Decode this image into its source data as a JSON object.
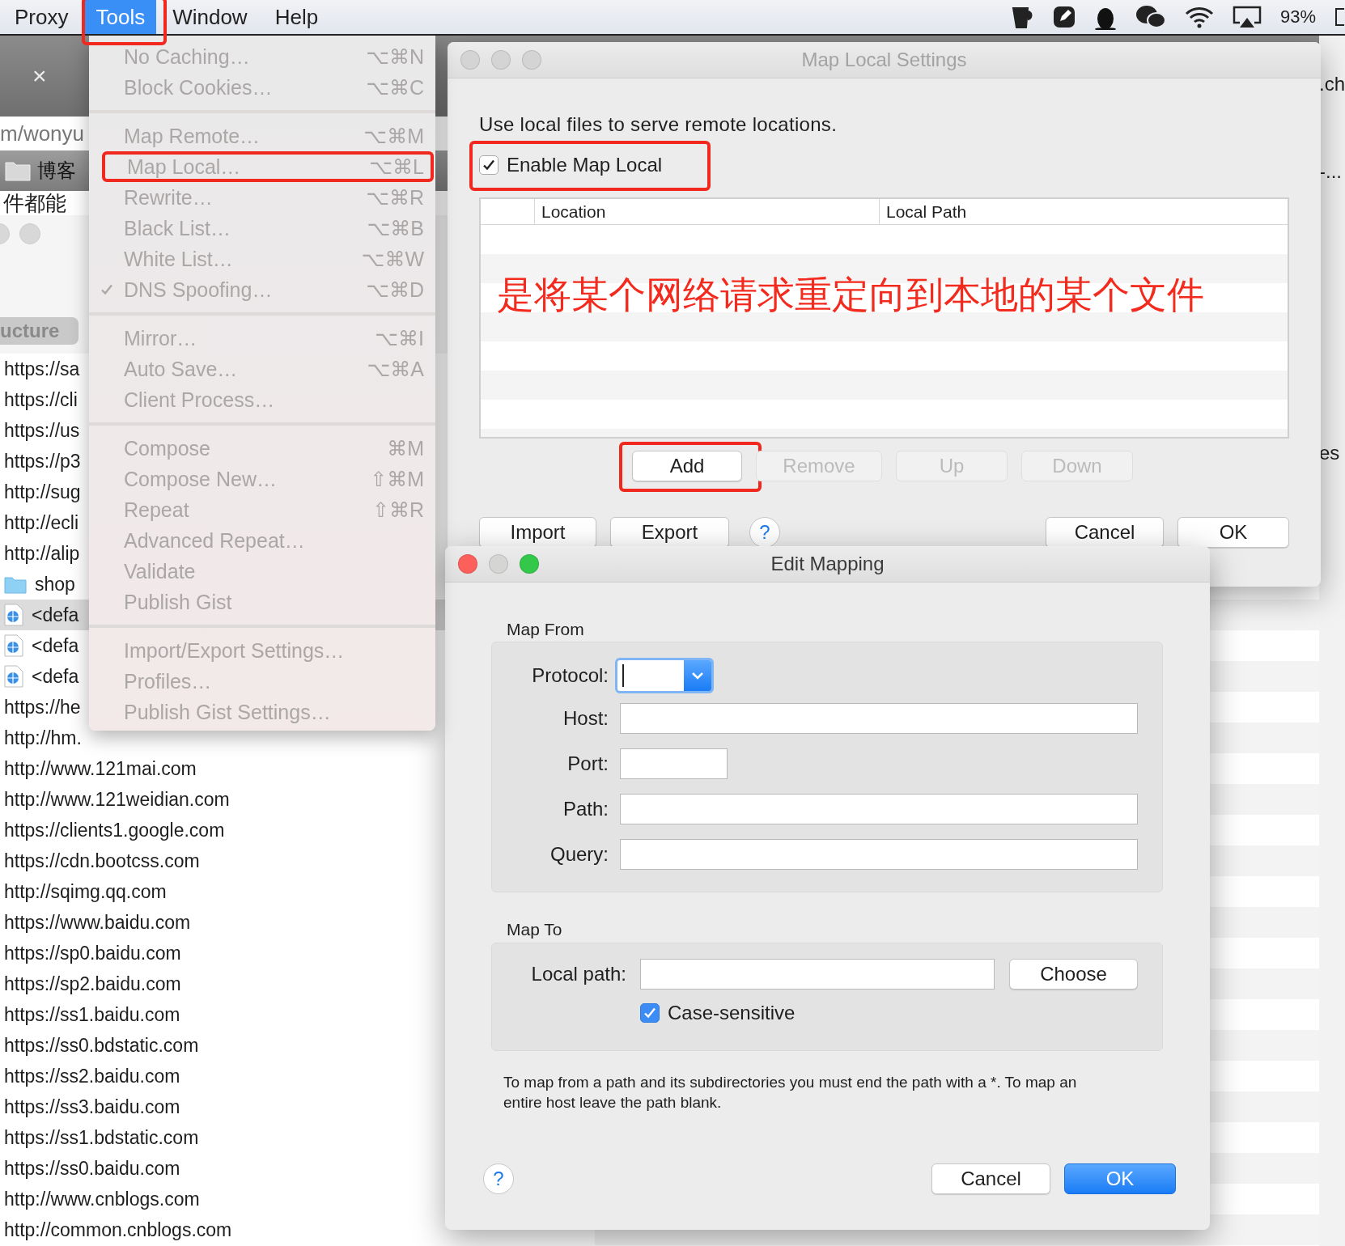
{
  "menu_bar": {
    "items": [
      {
        "label": "Proxy",
        "selected": false,
        "annotated": false
      },
      {
        "label": "Tools",
        "selected": true,
        "annotated": true
      },
      {
        "label": "Window",
        "selected": false,
        "annotated": false
      },
      {
        "label": "Help",
        "selected": false,
        "annotated": false
      }
    ],
    "battery": "93%"
  },
  "background_window": {
    "tab_close": "×",
    "address": "m/wonyu",
    "bookmark": "博客",
    "page_text": "件都能",
    "sidebar_tab": "ucture",
    "rows": [
      {
        "text": "https://sa",
        "kind": "url",
        "selected": false
      },
      {
        "text": "https://cli",
        "kind": "url",
        "selected": false
      },
      {
        "text": "https://us",
        "kind": "url",
        "selected": false
      },
      {
        "text": "https://p3",
        "kind": "url",
        "selected": false
      },
      {
        "text": "http://sug",
        "kind": "url",
        "selected": false
      },
      {
        "text": "http://ecli",
        "kind": "url",
        "selected": false
      },
      {
        "text": "http://alip",
        "kind": "url",
        "selected": false
      },
      {
        "text": "shop",
        "kind": "folder",
        "selected": false
      },
      {
        "text": "<defa",
        "kind": "file",
        "selected": true
      },
      {
        "text": "<defa",
        "kind": "file",
        "selected": false
      },
      {
        "text": "<defa",
        "kind": "file",
        "selected": false
      },
      {
        "text": "https://he",
        "kind": "url",
        "selected": false
      },
      {
        "text": "http://hm.",
        "kind": "url",
        "selected": false
      },
      {
        "text": "http://www.121mai.com",
        "kind": "url",
        "selected": false
      },
      {
        "text": "http://www.121weidian.com",
        "kind": "url",
        "selected": false
      },
      {
        "text": "https://clients1.google.com",
        "kind": "url",
        "selected": false
      },
      {
        "text": "https://cdn.bootcss.com",
        "kind": "url",
        "selected": false
      },
      {
        "text": "http://sqimg.qq.com",
        "kind": "url",
        "selected": false
      },
      {
        "text": "https://www.baidu.com",
        "kind": "url",
        "selected": false
      },
      {
        "text": "https://sp0.baidu.com",
        "kind": "url",
        "selected": false
      },
      {
        "text": "https://sp2.baidu.com",
        "kind": "url",
        "selected": false
      },
      {
        "text": "https://ss1.baidu.com",
        "kind": "url",
        "selected": false
      },
      {
        "text": "https://ss0.bdstatic.com",
        "kind": "url",
        "selected": false
      },
      {
        "text": "https://ss2.baidu.com",
        "kind": "url",
        "selected": false
      },
      {
        "text": "https://ss3.baidu.com",
        "kind": "url",
        "selected": false
      },
      {
        "text": "https://ss1.bdstatic.com",
        "kind": "url",
        "selected": false
      },
      {
        "text": "https://ss0.baidu.com",
        "kind": "url",
        "selected": false
      },
      {
        "text": "http://www.cnblogs.com",
        "kind": "url",
        "selected": false
      },
      {
        "text": "http://common.cnblogs.com",
        "kind": "url",
        "selected": false
      }
    ],
    "right_texts": [
      ".ch",
      "-...",
      "es"
    ]
  },
  "tools_menu": {
    "groups": [
      [
        {
          "label": "No Caching…",
          "shortcut": "⌥⌘N",
          "disabled": true,
          "checked": false,
          "annotated": false
        },
        {
          "label": "Block Cookies…",
          "shortcut": "⌥⌘C",
          "disabled": true,
          "checked": false,
          "annotated": false
        }
      ],
      [
        {
          "label": "Map Remote…",
          "shortcut": "⌥⌘M",
          "disabled": true,
          "checked": false,
          "annotated": false
        },
        {
          "label": "Map Local…",
          "shortcut": "⌥⌘L",
          "disabled": true,
          "checked": false,
          "annotated": true
        },
        {
          "label": "Rewrite…",
          "shortcut": "⌥⌘R",
          "disabled": true,
          "checked": false,
          "annotated": false
        },
        {
          "label": "Black List…",
          "shortcut": "⌥⌘B",
          "disabled": true,
          "checked": false,
          "annotated": false
        },
        {
          "label": "White List…",
          "shortcut": "⌥⌘W",
          "disabled": true,
          "checked": false,
          "annotated": false
        },
        {
          "label": "DNS Spoofing…",
          "shortcut": "⌥⌘D",
          "disabled": true,
          "checked": true,
          "annotated": false
        }
      ],
      [
        {
          "label": "Mirror…",
          "shortcut": "⌥⌘I",
          "disabled": true,
          "checked": false,
          "annotated": false
        },
        {
          "label": "Auto Save…",
          "shortcut": "⌥⌘A",
          "disabled": true,
          "checked": false,
          "annotated": false
        },
        {
          "label": "Client Process…",
          "disabled": true,
          "checked": false,
          "annotated": false
        }
      ],
      [
        {
          "label": "Compose",
          "shortcut": "⌘M",
          "disabled": true,
          "checked": false,
          "annotated": false
        },
        {
          "label": "Compose New…",
          "shortcut": "⇧⌘M",
          "disabled": true,
          "checked": false,
          "annotated": false
        },
        {
          "label": "Repeat",
          "shortcut": "⇧⌘R",
          "disabled": true,
          "checked": false,
          "annotated": false
        },
        {
          "label": "Advanced Repeat…",
          "disabled": true,
          "checked": false,
          "annotated": false
        },
        {
          "label": "Validate",
          "disabled": true,
          "checked": false,
          "annotated": false
        },
        {
          "label": "Publish Gist",
          "disabled": true,
          "checked": false,
          "annotated": false
        }
      ],
      [
        {
          "label": "Import/Export Settings…",
          "disabled": true,
          "checked": false,
          "annotated": false
        },
        {
          "label": "Profiles…",
          "disabled": true,
          "checked": false,
          "annotated": false
        },
        {
          "label": "Publish Gist Settings…",
          "disabled": true,
          "checked": false,
          "annotated": false
        }
      ]
    ]
  },
  "map_local_settings": {
    "title": "Map Local Settings",
    "active": false,
    "description": "Use local files to serve remote locations.",
    "enable": {
      "label": "Enable Map Local",
      "checked": true,
      "annotated": true
    },
    "table": {
      "columns": [
        {
          "label": "Location"
        },
        {
          "label": "Local Path"
        }
      ]
    },
    "annotation": "是将某个网络请求重定向到本地的某个文件",
    "row_buttons": [
      {
        "label": "Add",
        "disabled": false,
        "annotated": true
      },
      {
        "label": "Remove",
        "disabled": true,
        "annotated": false
      },
      {
        "label": "Up",
        "disabled": true,
        "annotated": false
      },
      {
        "label": "Down",
        "disabled": true,
        "annotated": false
      }
    ],
    "left_buttons": [
      "Import",
      "Export"
    ],
    "help": "?",
    "right_buttons": [
      "Cancel",
      "OK"
    ]
  },
  "edit_mapping": {
    "title": "Edit Mapping",
    "active": true,
    "lights": [
      {
        "kind": "close",
        "enabled": true
      },
      {
        "kind": "minimize",
        "enabled": false
      },
      {
        "kind": "zoom",
        "enabled": true
      }
    ],
    "map_from": {
      "title": "Map From",
      "fields": [
        {
          "label": "Protocol:",
          "kind": "select"
        },
        {
          "label": "Host:",
          "kind": "wide"
        },
        {
          "label": "Port:",
          "kind": "short"
        },
        {
          "label": "Path:",
          "kind": "wide"
        },
        {
          "label": "Query:",
          "kind": "wide"
        }
      ]
    },
    "map_to": {
      "title": "Map To",
      "local_path_label": "Local path:",
      "choose": "Choose",
      "case_sensitive": {
        "label": "Case-sensitive",
        "checked": true
      }
    },
    "note": "To map from a path and its subdirectories you must end the path with a *. To map an entire host leave the path blank.",
    "help": "?",
    "buttons": [
      {
        "label": "Cancel",
        "primary": false
      },
      {
        "label": "OK",
        "primary": true
      }
    ]
  }
}
